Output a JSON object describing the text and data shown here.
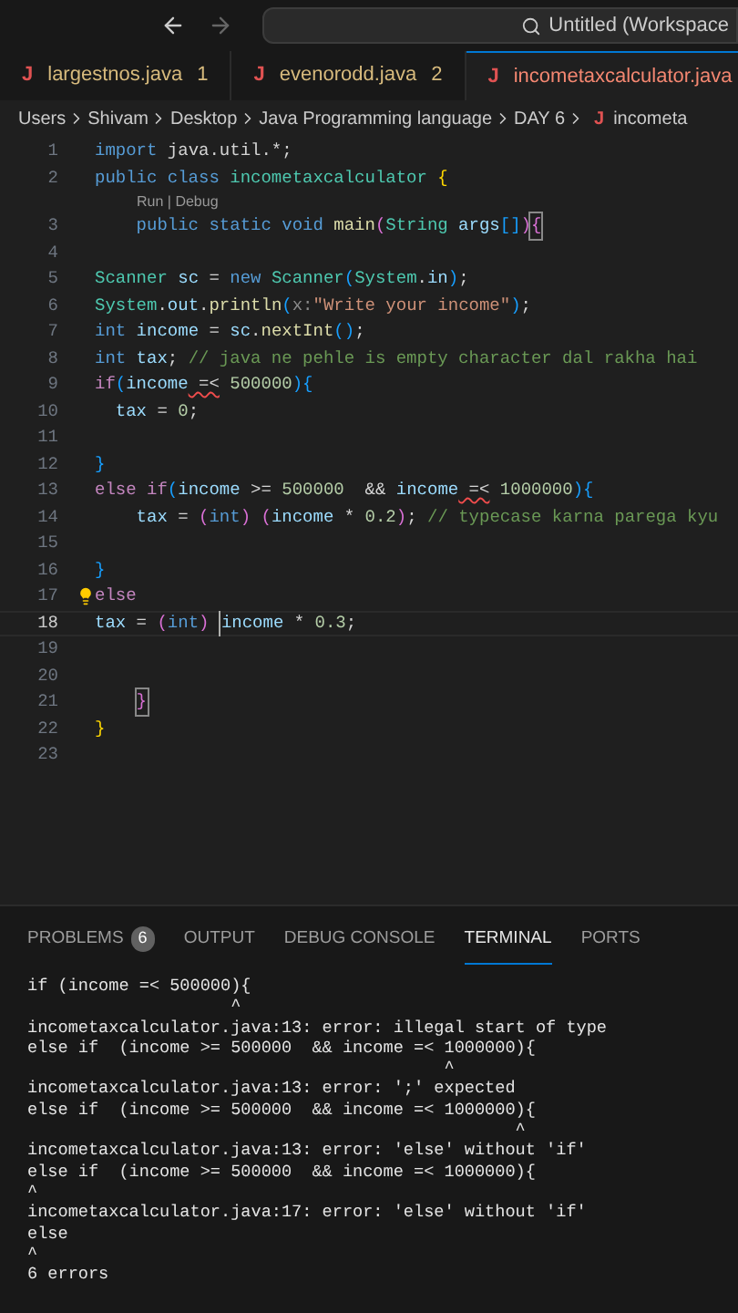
{
  "title_bar": {
    "search_text": "Untitled (Workspace"
  },
  "tabs": [
    {
      "icon": "J",
      "label": "largestnos.java",
      "badge": "1",
      "color": "#d7ba7d",
      "selected": false
    },
    {
      "icon": "J",
      "label": "evenorodd.java",
      "badge": "2",
      "color": "#d7ba7d",
      "selected": false
    },
    {
      "icon": "J",
      "label": "incometaxcalculator.java",
      "color": "#f48771",
      "selected": true
    }
  ],
  "breadcrumbs": [
    {
      "label": "Users"
    },
    {
      "label": "Shivam"
    },
    {
      "label": "Desktop"
    },
    {
      "label": "Java Programming language"
    },
    {
      "label": "DAY 6"
    },
    {
      "icon": "J",
      "label": "incometa"
    }
  ],
  "editor": {
    "lines": [
      {
        "kind": "code",
        "number": "1",
        "current": false,
        "segments": [
          {
            "text": "import",
            "kind": "keyword"
          },
          {
            "text": " java.util.*;",
            "kind": "plain"
          }
        ]
      },
      {
        "kind": "code",
        "number": "2",
        "current": false,
        "segments": [
          {
            "text": "public class ",
            "kind": "keyword"
          },
          {
            "text": "incometaxcalculator",
            "kind": "type"
          },
          {
            "text": " {",
            "kind": "brace1"
          }
        ]
      },
      {
        "kind": "codelens",
        "text": "Run | Debug"
      },
      {
        "kind": "code",
        "number": "3",
        "current": false,
        "segments": [
          {
            "text": "    public static void ",
            "kind": "keyword"
          },
          {
            "text": "main",
            "kind": "fn"
          },
          {
            "text": "(",
            "kind": "brace2"
          },
          {
            "text": "String",
            "kind": "type"
          },
          {
            "text": " args",
            "kind": "var"
          },
          {
            "text": "[]",
            "kind": "brace3"
          },
          {
            "text": ")",
            "kind": "brace2"
          },
          {
            "text": "{",
            "kind": "brace2",
            "boxed": true
          }
        ]
      },
      {
        "kind": "code",
        "number": "4",
        "current": false
      },
      {
        "kind": "code",
        "number": "5",
        "current": false,
        "segments": [
          {
            "text": "Scanner",
            "kind": "type"
          },
          {
            "text": " sc",
            "kind": "var"
          },
          {
            "text": " = ",
            "kind": "plain"
          },
          {
            "text": "new",
            "kind": "keyword"
          },
          {
            "text": " Scanner",
            "kind": "type"
          },
          {
            "text": "(",
            "kind": "brace3"
          },
          {
            "text": "System",
            "kind": "type"
          },
          {
            "text": ".",
            "kind": "plain"
          },
          {
            "text": "in",
            "kind": "var"
          },
          {
            "text": ")",
            "kind": "brace3"
          },
          {
            "text": ";",
            "kind": "plain"
          }
        ]
      },
      {
        "kind": "code",
        "number": "6",
        "current": false,
        "segments": [
          {
            "text": "System",
            "kind": "type"
          },
          {
            "text": ".",
            "kind": "plain"
          },
          {
            "text": "out",
            "kind": "var"
          },
          {
            "text": ".",
            "kind": "plain"
          },
          {
            "text": "println",
            "kind": "fn"
          },
          {
            "text": "(",
            "kind": "brace3"
          },
          {
            "text": "x:",
            "kind": "hint"
          },
          {
            "text": "\"Write your income\"",
            "kind": "string"
          },
          {
            "text": ")",
            "kind": "brace3"
          },
          {
            "text": ";",
            "kind": "plain"
          }
        ]
      },
      {
        "kind": "code",
        "number": "7",
        "current": false,
        "segments": [
          {
            "text": "int",
            "kind": "keyword"
          },
          {
            "text": " income",
            "kind": "var"
          },
          {
            "text": " = ",
            "kind": "plain"
          },
          {
            "text": "sc",
            "kind": "var"
          },
          {
            "text": ".",
            "kind": "plain"
          },
          {
            "text": "nextInt",
            "kind": "fn"
          },
          {
            "text": "()",
            "kind": "brace3"
          },
          {
            "text": ";",
            "kind": "plain"
          }
        ]
      },
      {
        "kind": "code",
        "number": "8",
        "current": false,
        "segments": [
          {
            "text": "int",
            "kind": "keyword"
          },
          {
            "text": " tax",
            "kind": "var"
          },
          {
            "text": "; ",
            "kind": "plain"
          },
          {
            "text": "// java ne pehle is empty character dal rakha hai",
            "kind": "comment"
          }
        ]
      },
      {
        "kind": "code",
        "number": "9",
        "current": false,
        "segments": [
          {
            "text": "if",
            "kind": "control"
          },
          {
            "text": "(",
            "kind": "brace3"
          },
          {
            "text": "income",
            "kind": "var"
          },
          {
            "text": " =<",
            "kind": "plain",
            "error": true
          },
          {
            "text": " 500000",
            "kind": "number"
          },
          {
            "text": "){",
            "kind": "brace3"
          }
        ]
      },
      {
        "kind": "code",
        "number": "10",
        "current": false,
        "segments": [
          {
            "text": "  tax",
            "kind": "var"
          },
          {
            "text": " = ",
            "kind": "plain"
          },
          {
            "text": "0",
            "kind": "number"
          },
          {
            "text": ";",
            "kind": "plain"
          }
        ]
      },
      {
        "kind": "code",
        "number": "11",
        "current": false
      },
      {
        "kind": "code",
        "number": "12",
        "current": false,
        "segments": [
          {
            "text": "}",
            "kind": "brace3"
          }
        ]
      },
      {
        "kind": "code",
        "number": "13",
        "current": false,
        "segments": [
          {
            "text": "else if",
            "kind": "control"
          },
          {
            "text": "(",
            "kind": "brace3"
          },
          {
            "text": "income",
            "kind": "var"
          },
          {
            "text": " >= ",
            "kind": "plain"
          },
          {
            "text": "500000",
            "kind": "number"
          },
          {
            "text": "  && ",
            "kind": "plain"
          },
          {
            "text": "income",
            "kind": "var"
          },
          {
            "text": " =<",
            "kind": "plain",
            "error": true
          },
          {
            "text": " 1000000",
            "kind": "number"
          },
          {
            "text": "){",
            "kind": "brace3"
          }
        ]
      },
      {
        "kind": "code",
        "number": "14",
        "current": false,
        "segments": [
          {
            "text": "    tax",
            "kind": "var"
          },
          {
            "text": " = ",
            "kind": "plain"
          },
          {
            "text": "(",
            "kind": "brace2"
          },
          {
            "text": "int",
            "kind": "keyword"
          },
          {
            "text": ")",
            "kind": "brace2"
          },
          {
            "text": " (",
            "kind": "brace2"
          },
          {
            "text": "income",
            "kind": "var"
          },
          {
            "text": " * ",
            "kind": "plain"
          },
          {
            "text": "0.2",
            "kind": "number"
          },
          {
            "text": ")",
            "kind": "brace2"
          },
          {
            "text": "; ",
            "kind": "plain"
          },
          {
            "text": "// typecase karna parega kyu",
            "kind": "comment"
          }
        ]
      },
      {
        "kind": "code",
        "number": "15",
        "current": false
      },
      {
        "kind": "code",
        "number": "16",
        "current": false,
        "segments": [
          {
            "text": "}",
            "kind": "brace3"
          }
        ]
      },
      {
        "kind": "code",
        "number": "17",
        "current": false,
        "lightbulb": true,
        "segments": [
          {
            "text": "else",
            "kind": "control"
          }
        ]
      },
      {
        "kind": "code",
        "number": "18",
        "current": true,
        "segments": [
          {
            "text": "tax",
            "kind": "var"
          },
          {
            "text": " = ",
            "kind": "plain"
          },
          {
            "text": "(",
            "kind": "brace2"
          },
          {
            "text": "int",
            "kind": "keyword"
          },
          {
            "text": ") ",
            "kind": "brace2"
          },
          {
            "text": "income",
            "kind": "var",
            "cursor": true
          },
          {
            "text": " * ",
            "kind": "plain"
          },
          {
            "text": "0.3",
            "kind": "number"
          },
          {
            "text": ";",
            "kind": "plain"
          }
        ]
      },
      {
        "kind": "code",
        "number": "19",
        "current": false
      },
      {
        "kind": "code",
        "number": "20",
        "current": false
      },
      {
        "kind": "code",
        "number": "21",
        "current": false,
        "segments": [
          {
            "text": "}",
            "kind": "brace2",
            "boxed": true,
            "indented": true
          }
        ]
      },
      {
        "kind": "code",
        "number": "22",
        "current": false,
        "segments": [
          {
            "text": "}",
            "kind": "brace1"
          }
        ]
      },
      {
        "kind": "code",
        "number": "23",
        "current": false
      }
    ]
  },
  "panel": {
    "tabs": [
      {
        "label": "PROBLEMS",
        "badge": "6",
        "selected": false
      },
      {
        "label": "OUTPUT",
        "selected": false
      },
      {
        "label": "DEBUG CONSOLE",
        "selected": false
      },
      {
        "label": "TERMINAL",
        "selected": true
      },
      {
        "label": "PORTS",
        "selected": false
      }
    ],
    "terminal_lines": [
      "if (income =< 500000){",
      "                    ^",
      "incometaxcalculator.java:13: error: illegal start of type",
      "else if  (income >= 500000  && income =< 1000000){",
      "                                         ^",
      "incometaxcalculator.java:13: error: ';' expected",
      "else if  (income >= 500000  && income =< 1000000){",
      "                                                ^",
      "incometaxcalculator.java:13: error: 'else' without 'if'",
      "else if  (income >= 500000  && income =< 1000000){",
      "^",
      "incometaxcalculator.java:17: error: 'else' without 'if'",
      "else",
      "^",
      "6 errors"
    ]
  }
}
